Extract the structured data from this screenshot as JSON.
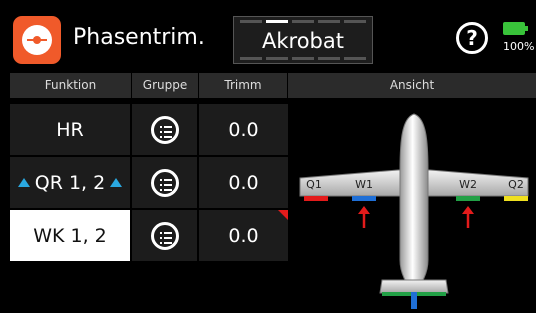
{
  "header": {
    "title": "Phasentrim.",
    "mode": "Akrobat",
    "help": "?",
    "battery_pct": "100%"
  },
  "table": {
    "columns": [
      "Funktion",
      "Gruppe",
      "Trimm",
      "Ansicht"
    ],
    "rows": [
      {
        "function": "HR",
        "trim": "0.0"
      },
      {
        "function": "QR 1, 2",
        "trim": "0.0"
      },
      {
        "function": "WK 1, 2",
        "trim": "0.0"
      }
    ]
  },
  "view": {
    "labels": {
      "q1": "Q1",
      "w1": "W1",
      "w2": "W2",
      "q2": "Q2"
    },
    "colors": {
      "q1": "#e31b1b",
      "w1": "#1f6fd6",
      "w2": "#22a046",
      "q2": "#f0e020",
      "arrow": "#e31b1b",
      "tail": "#22a046",
      "rudder": "#1f6fd6"
    }
  }
}
